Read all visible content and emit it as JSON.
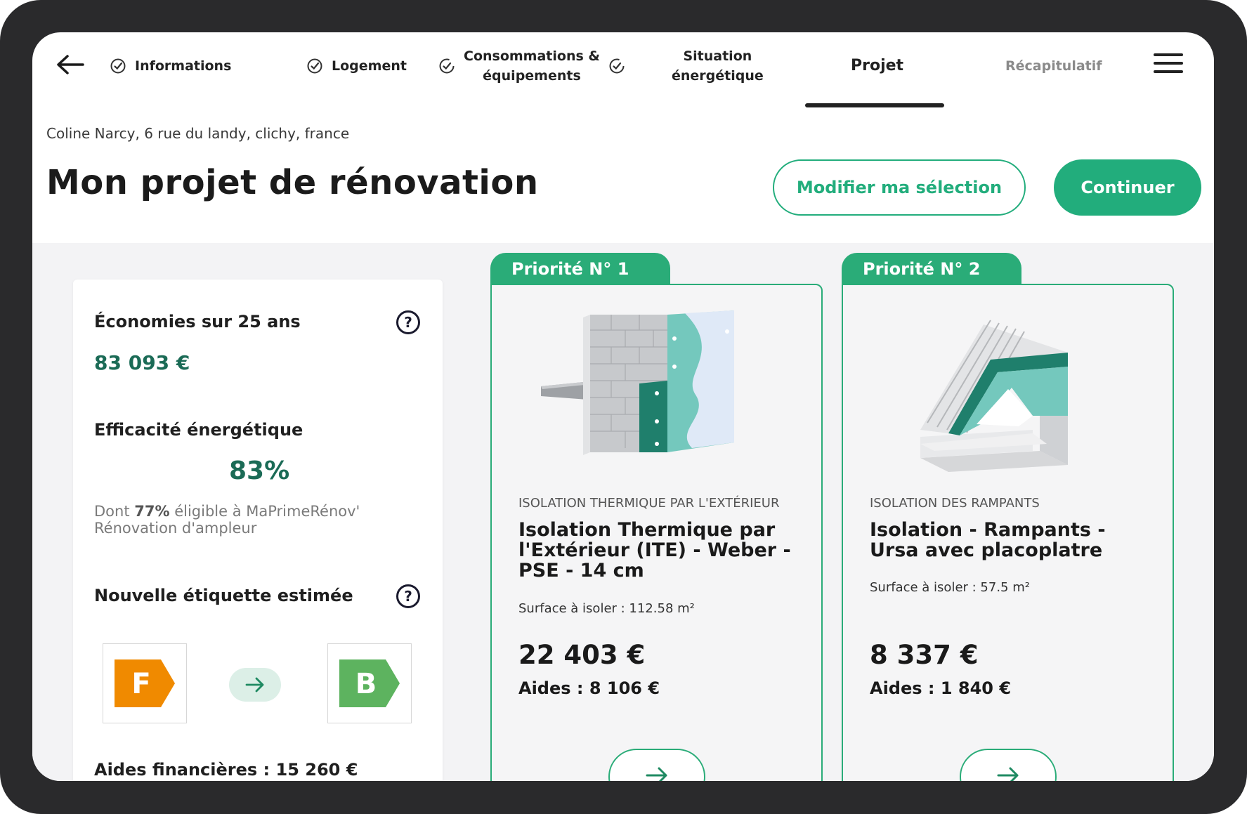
{
  "nav": {
    "steps": [
      {
        "label": "Informations",
        "state": "done"
      },
      {
        "label": "Logement",
        "state": "done"
      },
      {
        "label": "Consommations & équipements",
        "line1": "Consommations &",
        "line2": "équipements",
        "state": "done"
      },
      {
        "label": "Situation énergétique",
        "line1": "Situation",
        "line2": "énergétique",
        "state": "done"
      },
      {
        "label": "Projet",
        "state": "active"
      },
      {
        "label": "Récapitulatif",
        "state": "upcoming"
      }
    ],
    "back_icon": "arrow-left-icon",
    "menu_icon": "hamburger-menu-icon"
  },
  "address": "Coline Narcy, 6 rue du landy, clichy, france",
  "title": "Mon projet de rénovation",
  "actions": {
    "modify_label": "Modifier ma sélection",
    "continue_label": "Continuer"
  },
  "summary": {
    "savings_label": "Économies sur 25 ans",
    "savings_value": "83 093 €",
    "efficiency_label": "Efficacité énergétique",
    "efficiency_value": "83%",
    "note_prefix": "Dont ",
    "note_percent": "77%",
    "note_suffix": " éligible à MaPrimeRénov' Rénovation d'ampleur",
    "label_title": "Nouvelle étiquette estimée",
    "label_from": "F",
    "label_to": "B",
    "aides_total": "Aides financières : 15 260 €"
  },
  "cards": [
    {
      "priority": "Priorité N° 1",
      "category": "ISOLATION THERMIQUE PAR L'EXTÉRIEUR",
      "name": "Isolation Thermique par l'Extérieur (ITE) - Weber - PSE - 14 cm",
      "surface": "Surface à isoler : 112.58 m²",
      "price": "22 403 €",
      "aides": "Aides : 8 106 €"
    },
    {
      "priority": "Priorité N° 2",
      "category": "ISOLATION DES RAMPANTS",
      "name": "Isolation - Rampants - Ursa avec placoplatre",
      "surface": "Surface à isoler : 57.5 m²",
      "price": "8 337 €",
      "aides": "Aides : 1 840 €"
    }
  ],
  "colors": {
    "accent": "#22ad7c",
    "dark_green": "#1b6b56",
    "label_f": "#f08a00",
    "label_b": "#5db35f"
  }
}
